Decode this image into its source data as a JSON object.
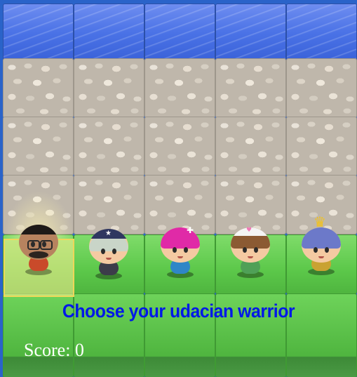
{
  "board": {
    "rows": [
      "water",
      "stone",
      "stone",
      "stone",
      "grass",
      "grass"
    ],
    "columns": 5
  },
  "characters": [
    {
      "id": "udacian-photo",
      "label": "photo-avatar",
      "selected": true
    },
    {
      "id": "boy",
      "label": "ninja-boy"
    },
    {
      "id": "cat-girl",
      "label": "pink-girl"
    },
    {
      "id": "horn-girl",
      "label": "cat-ear-girl"
    },
    {
      "id": "princess",
      "label": "princess"
    }
  ],
  "ui": {
    "title": "Choose your udacian warrior",
    "score": "Score: 0"
  },
  "colors": {
    "title": "#0018e8",
    "score": "#ffffff",
    "water": "#4a72e6",
    "grass": "#5cc84a",
    "stone": "#bfb7ab",
    "selector": "#f0d75a"
  }
}
